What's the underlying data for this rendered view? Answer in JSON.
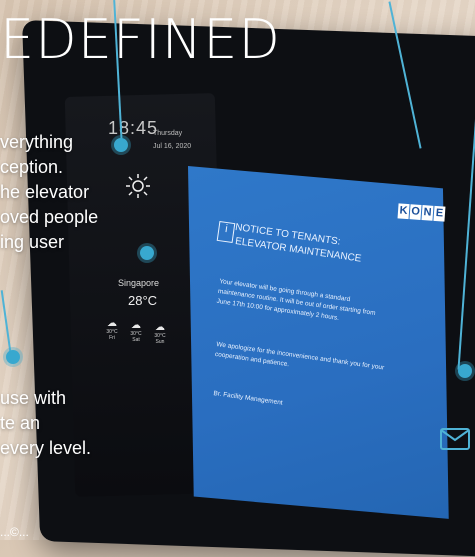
{
  "headline": "EDEFINED",
  "clock": {
    "time": "18:45",
    "day": "Thursday",
    "date": "Jul 16, 2020"
  },
  "weather": {
    "city": "Singapore",
    "temp": "28°C",
    "forecast": [
      {
        "temp": "30°C",
        "day": "Fri"
      },
      {
        "temp": "30°C",
        "day": "Sat"
      },
      {
        "temp": "30°C",
        "day": "Sun"
      }
    ]
  },
  "brand": "KONE",
  "notice": {
    "title1": "NOTICE TO TENANTS:",
    "title2": "ELEVATOR MAINTENANCE",
    "body1": "Your elevator will be going through a standard maintenance routine. It will be out of order starting from June 17th 10:00 for approximately 2 hours.",
    "body2": "We apologize for the inconvenience and thank you for your cooperation and patience.",
    "sign": "Br. Facility Management"
  },
  "paragraph1": [
    "verything",
    "ception.",
    "he elevator",
    "oved people",
    "ing user"
  ],
  "paragraph2": [
    "use with",
    "te an",
    "every level."
  ],
  "footer": "...©...",
  "colors": {
    "accent": "#38a8cf",
    "notice_blue": "#2a6ec0"
  }
}
